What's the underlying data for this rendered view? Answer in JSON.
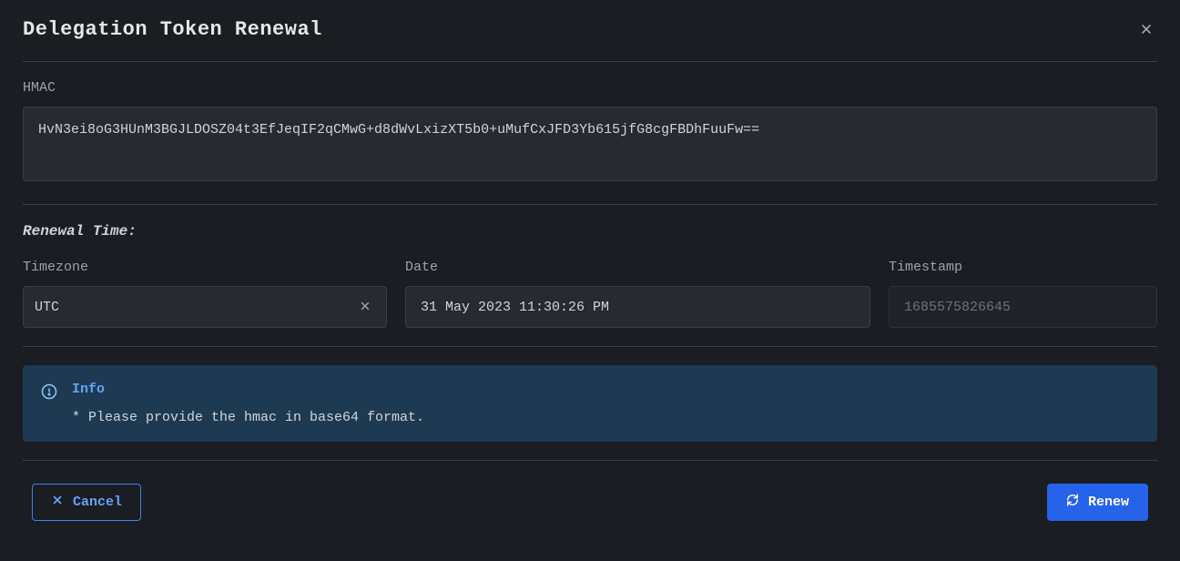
{
  "modal": {
    "title": "Delegation Token Renewal"
  },
  "hmac": {
    "label": "HMAC",
    "value": "HvN3ei8oG3HUnM3BGJLDOSZ04t3EfJeqIF2qCMwG+d8dWvLxizXT5b0+uMufCxJFD3Yb615jfG8cgFBDhFuuFw=="
  },
  "renewal": {
    "section_title": "Renewal Time:",
    "timezone": {
      "label": "Timezone",
      "value": "UTC"
    },
    "date": {
      "label": "Date",
      "value": "31 May 2023 11:30:26 PM"
    },
    "timestamp": {
      "label": "Timestamp",
      "value": "1685575826645"
    }
  },
  "info": {
    "title": "Info",
    "text": "* Please provide the hmac in base64 format."
  },
  "footer": {
    "cancel_label": "Cancel",
    "renew_label": "Renew"
  }
}
